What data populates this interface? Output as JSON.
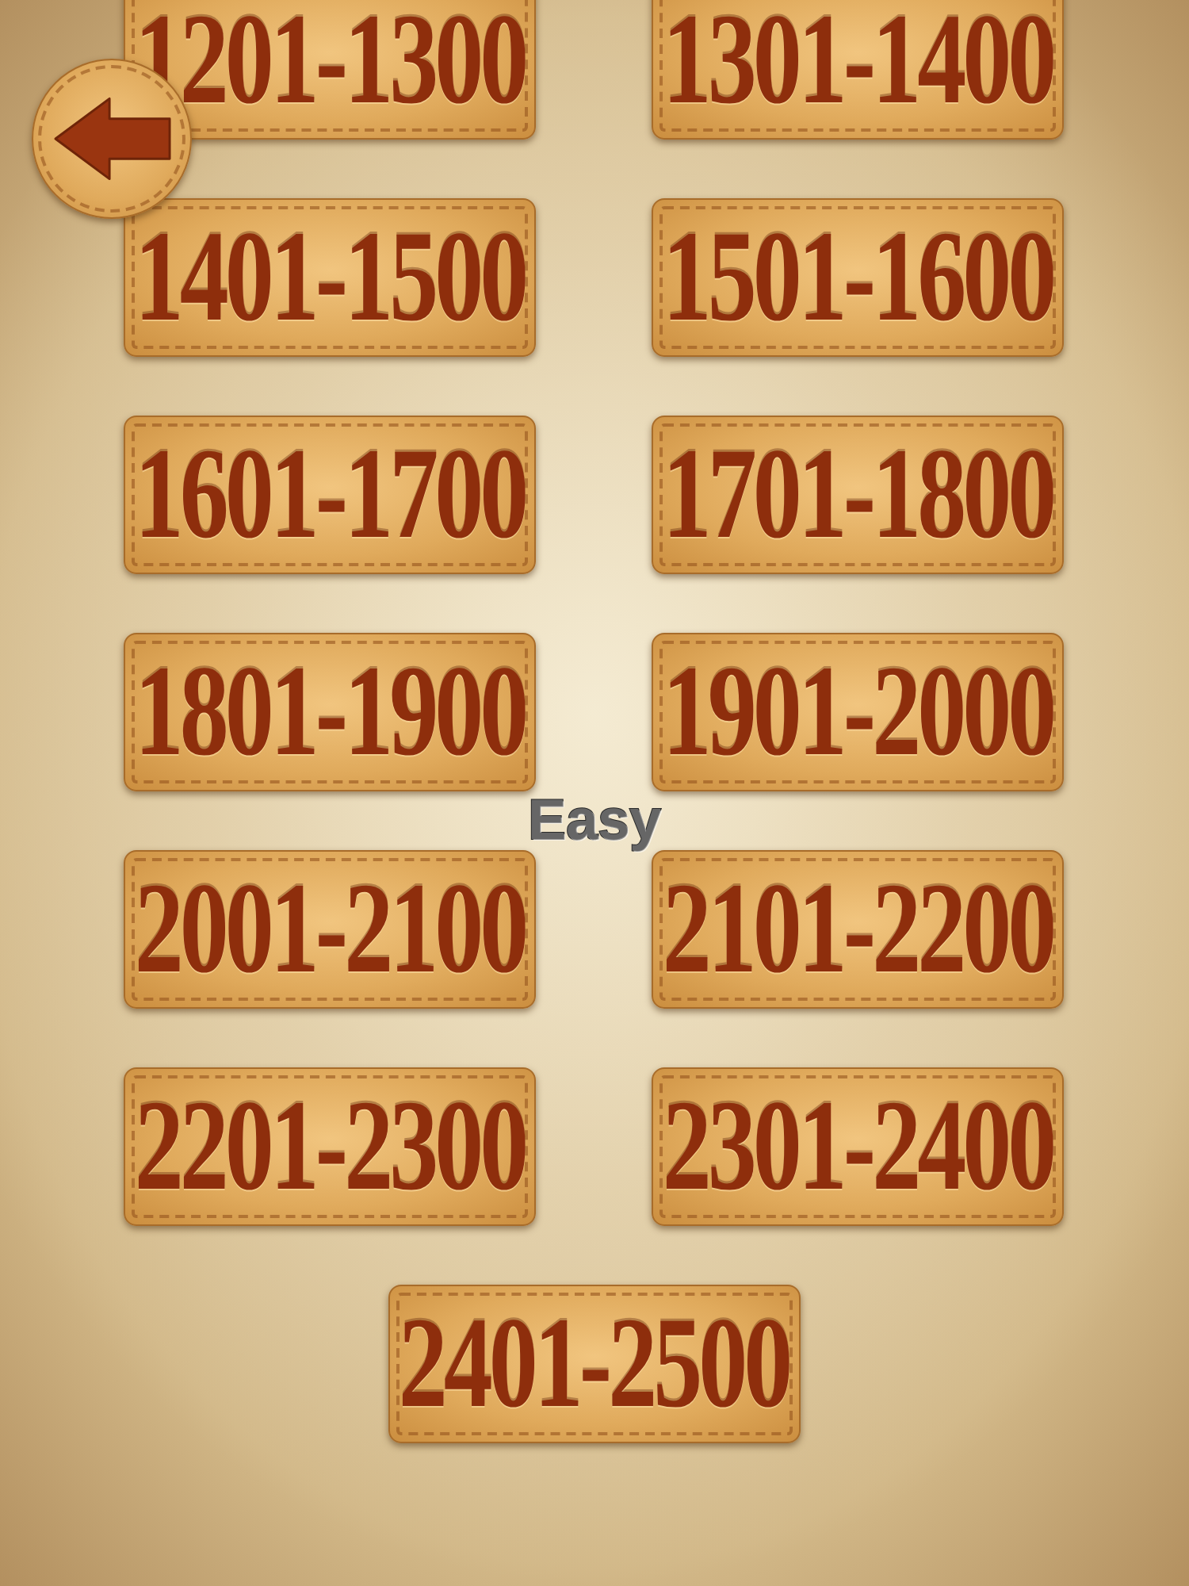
{
  "background_title": "Easy",
  "range_buttons": [
    "1201-1300",
    "1301-1400",
    "1401-1500",
    "1501-1600",
    "1601-1700",
    "1701-1800",
    "1801-1900",
    "1901-2000",
    "2001-2100",
    "2101-2200",
    "2201-2300",
    "2301-2400",
    "2401-2500"
  ]
}
